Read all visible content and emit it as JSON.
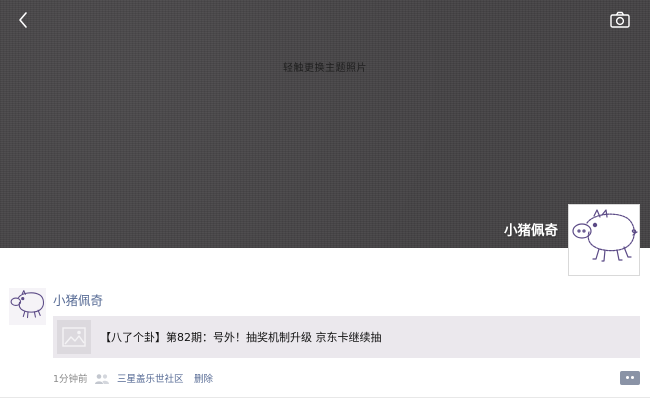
{
  "cover": {
    "hint": "轻触更换主题照片",
    "username": "小猪佩奇",
    "avatar_icon": "pig-doodle-icon",
    "back_icon": "back-chevron-icon",
    "camera_icon": "camera-icon"
  },
  "post": {
    "author": "小猪佩奇",
    "avatar_icon": "pig-doodle-icon",
    "link": {
      "thumbnail_icon": "image-placeholder-icon",
      "title": "【八了个卦】第82期：号外！抽奖机制升级 京东卡继续抽"
    },
    "time": "1分钟前",
    "visibility_icon": "group-icon",
    "location": "三星盖乐世社区",
    "delete_label": "删除",
    "comment_icon": "comment-icon"
  },
  "colors": {
    "cover_bg": "#464446",
    "link_blue": "#576b95",
    "card_bg": "#ebe8ed",
    "meta_gray": "#8a8a8a"
  }
}
